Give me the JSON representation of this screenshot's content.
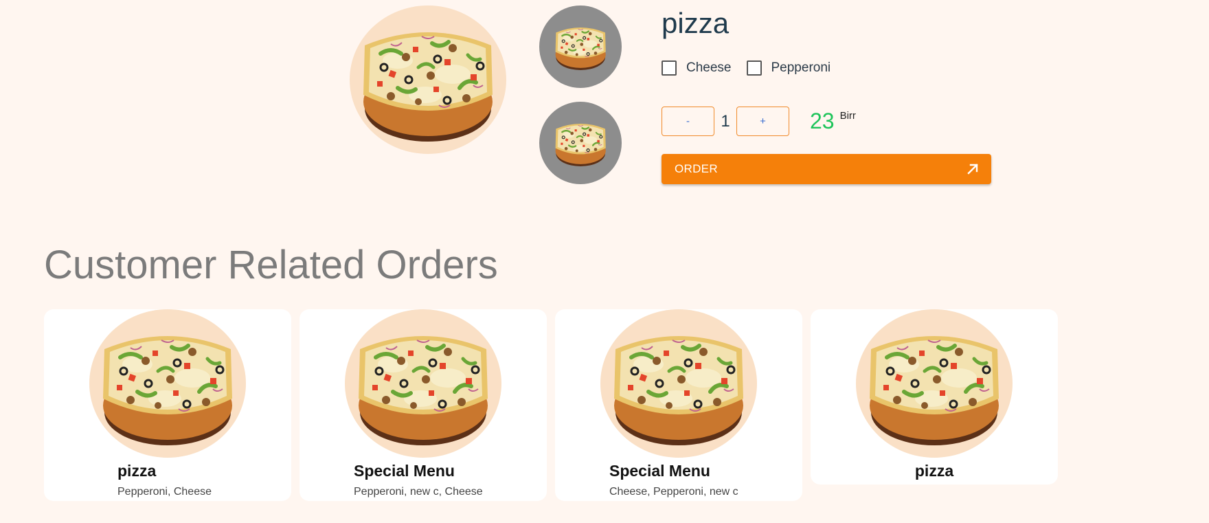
{
  "product": {
    "title": "pizza",
    "options": [
      {
        "label": "Cheese",
        "checked": false
      },
      {
        "label": "Pepperoni",
        "checked": false
      }
    ],
    "quantity": {
      "decrement_label": "-",
      "value": "1",
      "increment_label": "+"
    },
    "price": {
      "amount": "23",
      "currency": "Birr"
    },
    "order_button": {
      "label": "ORDER",
      "icon": "arrow-up-right-icon"
    }
  },
  "related": {
    "title": "Customer Related Orders",
    "cards": [
      {
        "name": "pizza",
        "toppings": "Pepperoni, Cheese"
      },
      {
        "name": "Special Menu",
        "toppings": "Pepperoni, new c, Cheese"
      },
      {
        "name": "Special Menu",
        "toppings": "Cheese, Pepperoni, new c"
      },
      {
        "name": "pizza",
        "toppings": ""
      }
    ]
  },
  "colors": {
    "accent": "#f5800a",
    "price": "#1ec45a",
    "background": "#fff6f0",
    "image_circle": "#fae0c6",
    "thumb_circle": "#8d8d8d"
  }
}
